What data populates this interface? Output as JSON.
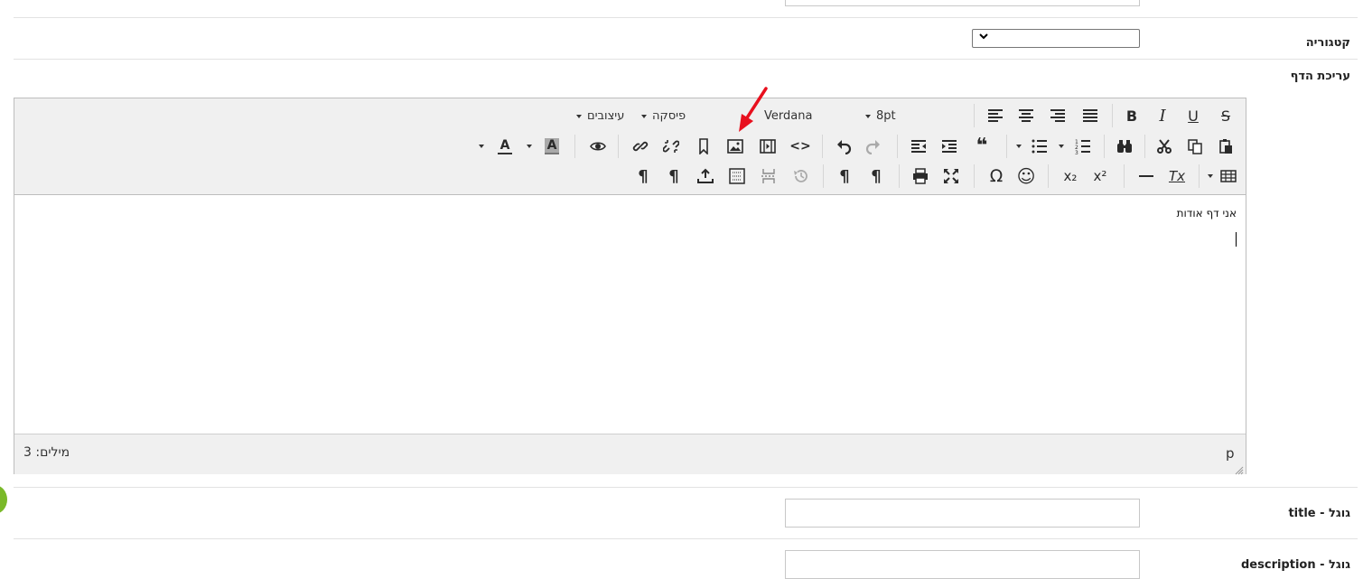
{
  "form": {
    "category_label": "קטגוריה",
    "category_select_value": "",
    "page_edit_label": "עריכת הדף",
    "google_title_label": "גוגל - title",
    "google_description_label": "גוגל - description",
    "google_title_value": "",
    "google_description_value": ""
  },
  "editor": {
    "toolbar": {
      "font_size": "8pt",
      "font_family": "Verdana",
      "paragraph": "פיסקה",
      "styles": "עיצובים",
      "buttons": {
        "strikethrough": "S",
        "underline": "U",
        "italic": "I",
        "bold": "B",
        "blockquote": "❝",
        "special_char": "Ω",
        "smiley": "☺",
        "subscript": "x₂",
        "superscript": "x²",
        "clear_format": "Tx",
        "text_color": "A",
        "bg_color": "A",
        "code": "<>"
      }
    },
    "content_text": "אני דף אודות",
    "status": {
      "path": "p",
      "word_count": "מילים: 3"
    }
  },
  "colors": {
    "annotation_arrow": "#e8101e",
    "toolbar_bg": "#f0f0f0",
    "green_badge": "#7ab929"
  }
}
